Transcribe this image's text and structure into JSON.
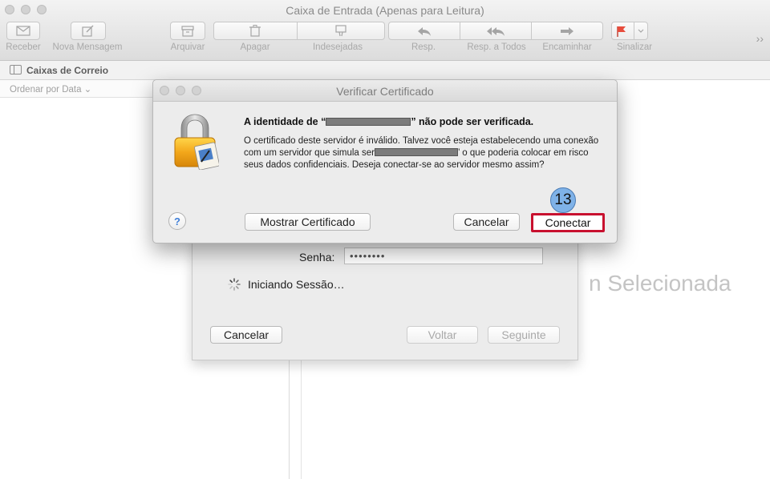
{
  "window": {
    "title": "Caixa de Entrada (Apenas para Leitura)"
  },
  "toolbar": {
    "items": [
      {
        "label": "Receber",
        "icon": "envelope-icon"
      },
      {
        "label": "Nova Mensagem",
        "icon": "compose-icon"
      },
      {
        "label": "Arquivar",
        "icon": "archive-icon"
      },
      {
        "label": "Apagar",
        "icon": "trash-icon"
      },
      {
        "label": "Indesejadas",
        "icon": "junk-icon"
      },
      {
        "label": "Resp.",
        "icon": "reply-icon"
      },
      {
        "label": "Resp. a Todos",
        "icon": "reply-all-icon"
      },
      {
        "label": "Encaminhar",
        "icon": "forward-icon"
      },
      {
        "label": "Sinalizar",
        "icon": "flag-icon"
      }
    ],
    "overflow": "››"
  },
  "mailbox_bar": {
    "label": "Caixas de Correio"
  },
  "sort": {
    "label": "Ordenar por Data ⌄"
  },
  "content": {
    "no_selection": "n Selecionada"
  },
  "setup_sheet": {
    "password_label": "Senha:",
    "password_value": "••••••••",
    "status": "Iniciando Sessão…",
    "cancel": "Cancelar",
    "back": "Voltar",
    "next": "Seguinte"
  },
  "certificate_dialog": {
    "title": "Verificar Certificado",
    "heading_prefix": "A identidade de “",
    "heading_suffix": "” não pode ser verificada.",
    "body_part1": "O certificado deste servidor é inválido. Talvez você esteja estabelecendo uma conexão com um servidor que simula ser",
    "body_part2": "’ o que poderia colocar em risco seus dados confidenciais. Deseja conectar-se ao servidor mesmo assim?",
    "help": "?",
    "show_certificate": "Mostrar Certificado",
    "cancel": "Cancelar",
    "connect": "Conectar"
  },
  "annotation": {
    "step": "13",
    "highlight_color": "#c8102e",
    "badge_color": "#7fb2e8"
  }
}
